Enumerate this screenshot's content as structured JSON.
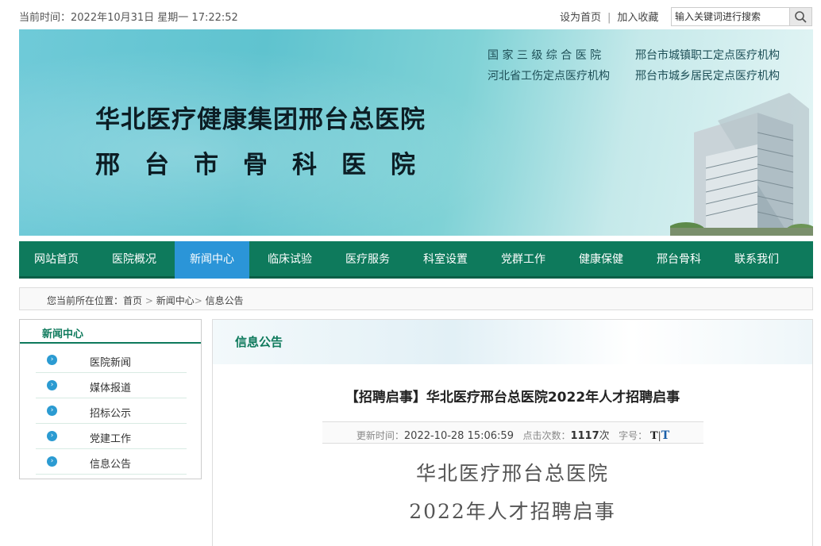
{
  "topbar": {
    "datetime": "当前时间：2022年10月31日 星期一 17:22:52",
    "set_home": "设为首页",
    "separator": "|",
    "add_favorite": "加入收藏",
    "search_placeholder": "输入关键词进行搜索"
  },
  "banner": {
    "tag1": "国 家 三 级 综 合 医 院",
    "tag2": "邢台市城镇职工定点医疗机构",
    "tag3": "河北省工伤定点医疗机构",
    "tag4": "邢台市城乡居民定点医疗机构",
    "title1": "华北医疗健康集团邢台总医院",
    "title2": "邢台市骨科医院"
  },
  "nav": {
    "items": [
      "网站首页",
      "医院概况",
      "新闻中心",
      "临床试验",
      "医疗服务",
      "科室设置",
      "党群工作",
      "健康保健",
      "邢台骨科",
      "联系我们"
    ],
    "active_index": 2
  },
  "breadcrumb": {
    "prefix": "您当前所在位置：",
    "home": "首页",
    "arrow1": " > ",
    "news": "新闻中心",
    "arrow2": "> ",
    "current": "信息公告"
  },
  "sidebar": {
    "title": "新闻中心",
    "items": [
      "医院新闻",
      "媒体报道",
      "招标公示",
      "党建工作",
      "信息公告"
    ]
  },
  "main": {
    "section_title": "信息公告",
    "article_title": "【招聘启事】华北医疗邢台总医院2022年人才招聘启事",
    "meta": {
      "updated_label": "更新时间：",
      "updated_value": "2022-10-28 15:06:59",
      "clicks_label": "点击次数：",
      "clicks_value": "1117",
      "clicks_unit": "次",
      "fontsize_label": "字号：",
      "font_small": "T",
      "font_sep": "|",
      "font_large": "T"
    },
    "body_line1": "华北医疗邢台总医院",
    "body_line2": "2022年人才招聘启事"
  },
  "colors": {
    "nav_green": "#0e7a5c",
    "nav_active": "#2b95d8",
    "banner_cyan": "#5fc3cf"
  }
}
